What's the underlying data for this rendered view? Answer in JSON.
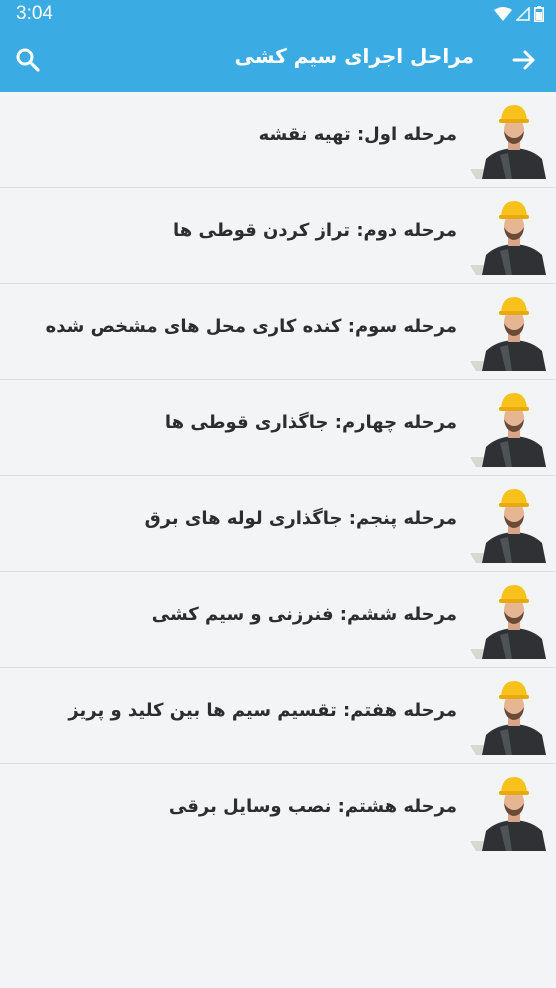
{
  "status_bar": {
    "time": "3:04",
    "icons": [
      "wifi-icon",
      "signal-icon",
      "battery-icon"
    ]
  },
  "app_bar": {
    "title": "مراحل اجرای سیم کشی",
    "back_icon": "arrow-forward-icon",
    "search_icon": "search-icon"
  },
  "colors": {
    "primary": "#3babe3",
    "background": "#f2f4f5",
    "text": "#2d2d2d",
    "divider": "#d9dcde",
    "helmet": "#f7c21a"
  },
  "items": [
    {
      "label": "مرحله اول: تهیه نقشه",
      "icon": "electrician-avatar"
    },
    {
      "label": "مرحله دوم: تراز کردن قوطی ها",
      "icon": "electrician-avatar"
    },
    {
      "label": "مرحله سوم: کنده کاری محل های مشخص شده",
      "icon": "electrician-avatar"
    },
    {
      "label": "مرحله چهارم: جاگذاری قوطی ها",
      "icon": "electrician-avatar"
    },
    {
      "label": "مرحله پنجم: جاگذاری لوله های برق",
      "icon": "electrician-avatar"
    },
    {
      "label": "مرحله ششم: فنرزنی و سیم کشی",
      "icon": "electrician-avatar"
    },
    {
      "label": "مرحله هفتم: تقسیم سیم ها بین کلید و پریز",
      "icon": "electrician-avatar"
    },
    {
      "label": "مرحله هشتم: نصب وسایل برقی",
      "icon": "electrician-avatar"
    }
  ]
}
